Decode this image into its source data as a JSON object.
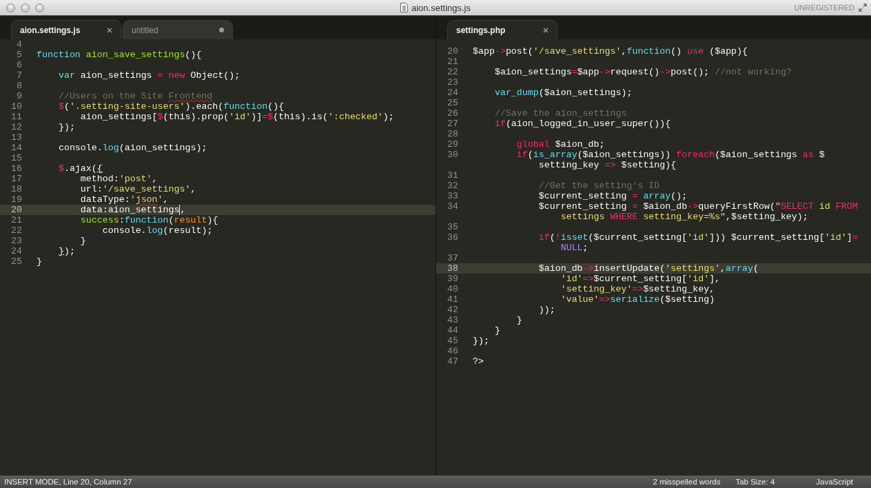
{
  "window": {
    "title": "aion.settings.js",
    "badge": "UNREGISTERED"
  },
  "panes": [
    {
      "tabs": [
        {
          "label": "aion.settings.js",
          "selected": true,
          "modified": false
        },
        {
          "label": "untitled",
          "selected": false,
          "modified": true
        }
      ],
      "lines": [
        {
          "number": "4",
          "current": false
        },
        {
          "number": "5",
          "current": false,
          "tokens": [
            {
              "kind": "type",
              "text": "function"
            },
            {
              "kind": "name",
              "text": " aion_save_settings"
            },
            {
              "kind": "plain",
              "text": "(){"
            }
          ]
        },
        {
          "number": "6",
          "current": false
        },
        {
          "number": "7",
          "current": false,
          "tokens": [
            {
              "kind": "type",
              "text": "    var"
            },
            {
              "kind": "plain",
              "text": " aion_settings "
            },
            {
              "kind": "keyword",
              "text": "="
            },
            {
              "kind": "keyword",
              "text": " new"
            },
            {
              "kind": "plain",
              "text": " Object();"
            }
          ]
        },
        {
          "number": "8",
          "current": false
        },
        {
          "number": "9",
          "current": false,
          "tokens": [
            {
              "kind": "comment",
              "text": "    //Users on the Site"
            },
            {
              "kind": "comment",
              "text": " Frontend",
              "misspelled": true
            }
          ]
        },
        {
          "number": "10",
          "current": false,
          "tokens": [
            {
              "kind": "keyword",
              "text": "    $"
            },
            {
              "kind": "plain",
              "text": "("
            },
            {
              "kind": "string",
              "text": "'.setting-site-users'"
            },
            {
              "kind": "plain",
              "text": ").each("
            },
            {
              "kind": "type",
              "text": "function"
            },
            {
              "kind": "plain",
              "text": "(){"
            }
          ]
        },
        {
          "number": "11",
          "current": false,
          "tokens": [
            {
              "kind": "plain",
              "text": "        aion_settings["
            },
            {
              "kind": "keyword",
              "text": "$"
            },
            {
              "kind": "plain",
              "text": "(this).prop("
            },
            {
              "kind": "string",
              "text": "'id'"
            },
            {
              "kind": "plain",
              "text": ")]"
            },
            {
              "kind": "keyword",
              "text": "="
            },
            {
              "kind": "keyword",
              "text": "$"
            },
            {
              "kind": "plain",
              "text": "(this).is("
            },
            {
              "kind": "string",
              "text": "':checked'"
            },
            {
              "kind": "plain",
              "text": ");"
            }
          ]
        },
        {
          "number": "12",
          "current": false,
          "tokens": [
            {
              "kind": "plain",
              "text": "    });"
            }
          ]
        },
        {
          "number": "13",
          "current": false
        },
        {
          "number": "14",
          "current": false,
          "tokens": [
            {
              "kind": "plain",
              "text": "    console."
            },
            {
              "kind": "type",
              "text": "log"
            },
            {
              "kind": "plain",
              "text": "(aion_settings);"
            }
          ]
        },
        {
          "number": "15",
          "current": false
        },
        {
          "number": "16",
          "current": false,
          "tokens": [
            {
              "kind": "keyword",
              "text": "    $"
            },
            {
              "kind": "plain",
              "text": ".ajax("
            },
            {
              "kind": "plain",
              "text": "{",
              "matched": true
            }
          ]
        },
        {
          "number": "17",
          "current": false,
          "tokens": [
            {
              "kind": "plain",
              "text": "        method:"
            },
            {
              "kind": "string",
              "text": "'post'"
            },
            {
              "kind": "plain",
              "text": ","
            }
          ]
        },
        {
          "number": "18",
          "current": false,
          "tokens": [
            {
              "kind": "plain",
              "text": "        url:"
            },
            {
              "kind": "string",
              "text": "'/save_settings'"
            },
            {
              "kind": "plain",
              "text": ","
            }
          ]
        },
        {
          "number": "19",
          "current": false,
          "tokens": [
            {
              "kind": "plain",
              "text": "        dataType:"
            },
            {
              "kind": "string",
              "text": "'"
            },
            {
              "kind": "string",
              "text": "json",
              "misspelled": true
            },
            {
              "kind": "string",
              "text": "'"
            },
            {
              "kind": "plain",
              "text": ","
            }
          ]
        },
        {
          "number": "20",
          "current": true,
          "tokens": [
            {
              "kind": "plain",
              "text": "        data:aion_settings",
              "caret": true
            },
            {
              "kind": "plain",
              "text": ","
            }
          ]
        },
        {
          "number": "21",
          "current": false,
          "tokens": [
            {
              "kind": "name",
              "text": "        success"
            },
            {
              "kind": "plain",
              "text": ":"
            },
            {
              "kind": "type",
              "text": "function"
            },
            {
              "kind": "plain",
              "text": "("
            },
            {
              "kind": "param",
              "text": "result"
            },
            {
              "kind": "plain",
              "text": "){"
            }
          ]
        },
        {
          "number": "22",
          "current": false,
          "tokens": [
            {
              "kind": "plain",
              "text": "            console."
            },
            {
              "kind": "type",
              "text": "log"
            },
            {
              "kind": "plain",
              "text": "(result);"
            }
          ]
        },
        {
          "number": "23",
          "current": false,
          "tokens": [
            {
              "kind": "plain",
              "text": "        }"
            }
          ]
        },
        {
          "number": "24",
          "current": false,
          "tokens": [
            {
              "kind": "plain",
              "text": "    }",
              "matched": true
            },
            {
              "kind": "plain",
              "text": ");"
            }
          ]
        },
        {
          "number": "25",
          "current": false,
          "tokens": [
            {
              "kind": "plain",
              "text": "}"
            }
          ]
        }
      ]
    },
    {
      "tabs": [
        {
          "label": "settings.php",
          "selected": true,
          "modified": false
        }
      ],
      "lines": [
        {
          "number": "20",
          "current": false,
          "tokens": [
            {
              "kind": "plain",
              "text": "$app"
            },
            {
              "kind": "keyword",
              "text": "->"
            },
            {
              "kind": "plain",
              "text": "post("
            },
            {
              "kind": "string",
              "text": "'/save_settings'"
            },
            {
              "kind": "plain",
              "text": ","
            },
            {
              "kind": "type",
              "text": "function"
            },
            {
              "kind": "plain",
              "text": "()"
            },
            {
              "kind": "keyword",
              "text": " use"
            },
            {
              "kind": "plain",
              "text": " ($app){"
            }
          ]
        },
        {
          "number": "21",
          "current": false
        },
        {
          "number": "22",
          "current": false,
          "tokens": [
            {
              "kind": "plain",
              "text": "    $aion_settings"
            },
            {
              "kind": "keyword",
              "text": "="
            },
            {
              "kind": "plain",
              "text": "$app"
            },
            {
              "kind": "keyword",
              "text": "->"
            },
            {
              "kind": "plain",
              "text": "request()"
            },
            {
              "kind": "keyword",
              "text": "->"
            },
            {
              "kind": "plain",
              "text": "post();"
            },
            {
              "kind": "comment",
              "text": " //not working?"
            }
          ]
        },
        {
          "number": "23",
          "current": false
        },
        {
          "number": "24",
          "current": false,
          "tokens": [
            {
              "kind": "type",
              "text": "    var_dump"
            },
            {
              "kind": "plain",
              "text": "($aion_settings);"
            }
          ]
        },
        {
          "number": "25",
          "current": false
        },
        {
          "number": "26",
          "current": false,
          "tokens": [
            {
              "kind": "comment",
              "text": "    //Save the aion_settings"
            }
          ]
        },
        {
          "number": "27",
          "current": false,
          "tokens": [
            {
              "kind": "keyword",
              "text": "    if"
            },
            {
              "kind": "plain",
              "text": "(aion_logged_in_user_super()){"
            }
          ]
        },
        {
          "number": "28",
          "current": false
        },
        {
          "number": "29",
          "current": false,
          "tokens": [
            {
              "kind": "keyword",
              "text": "        global"
            },
            {
              "kind": "plain",
              "text": " $aion_db;"
            }
          ]
        },
        {
          "number": "30",
          "current": false,
          "tokens": [
            {
              "kind": "keyword",
              "text": "        if"
            },
            {
              "kind": "plain",
              "text": "("
            },
            {
              "kind": "type",
              "text": "is_array"
            },
            {
              "kind": "plain",
              "text": "($aion_settings))"
            },
            {
              "kind": "keyword",
              "text": " foreach"
            },
            {
              "kind": "plain",
              "text": "($aion_settings"
            },
            {
              "kind": "keyword",
              "text": " as"
            },
            {
              "kind": "plain",
              "text": " $"
            }
          ],
          "wrap": [
            {
              "kind": "plain",
              "text": "            setting_key"
            },
            {
              "kind": "keyword",
              "text": " =>"
            },
            {
              "kind": "plain",
              "text": " $setting){"
            }
          ]
        },
        {
          "number": "31",
          "current": false
        },
        {
          "number": "32",
          "current": false,
          "tokens": [
            {
              "kind": "comment",
              "text": "            //Get the setting's ID"
            }
          ]
        },
        {
          "number": "33",
          "current": false,
          "tokens": [
            {
              "kind": "plain",
              "text": "            $current_setting"
            },
            {
              "kind": "keyword",
              "text": " ="
            },
            {
              "kind": "type",
              "text": " array"
            },
            {
              "kind": "plain",
              "text": "();"
            }
          ]
        },
        {
          "number": "34",
          "current": false,
          "tokens": [
            {
              "kind": "plain",
              "text": "            $current_setting"
            },
            {
              "kind": "keyword",
              "text": " ="
            },
            {
              "kind": "plain",
              "text": " $aion_db"
            },
            {
              "kind": "keyword",
              "text": "->"
            },
            {
              "kind": "plain",
              "text": "queryFirstRow("
            },
            {
              "kind": "string",
              "text": "\""
            },
            {
              "kind": "keyword",
              "text": "SELECT"
            },
            {
              "kind": "string",
              "text": " id"
            },
            {
              "kind": "keyword",
              "text": " FROM"
            }
          ],
          "wrap": [
            {
              "kind": "string",
              "text": "                settings"
            },
            {
              "kind": "keyword",
              "text": " WHERE"
            },
            {
              "kind": "string",
              "text": " setting_key=%s\""
            },
            {
              "kind": "plain",
              "text": ",$setting_key);"
            }
          ]
        },
        {
          "number": "35",
          "current": false
        },
        {
          "number": "36",
          "current": false,
          "tokens": [
            {
              "kind": "keyword",
              "text": "            if"
            },
            {
              "kind": "plain",
              "text": "("
            },
            {
              "kind": "keyword",
              "text": "!"
            },
            {
              "kind": "type",
              "text": "isset"
            },
            {
              "kind": "plain",
              "text": "($current_setting["
            },
            {
              "kind": "string",
              "text": "'id'"
            },
            {
              "kind": "plain",
              "text": "])) $current_setting["
            },
            {
              "kind": "string",
              "text": "'id'"
            },
            {
              "kind": "plain",
              "text": "]"
            },
            {
              "kind": "keyword",
              "text": "="
            }
          ],
          "wrap": [
            {
              "kind": "constant",
              "text": "                NULL"
            },
            {
              "kind": "plain",
              "text": ";"
            }
          ]
        },
        {
          "number": "37",
          "current": false
        },
        {
          "number": "38",
          "current": true,
          "tokens": [
            {
              "kind": "plain",
              "text": "            $aion_db"
            },
            {
              "kind": "keyword",
              "text": "->"
            },
            {
              "kind": "plain",
              "text": "insertUpdate("
            },
            {
              "kind": "string",
              "text": "'settings'"
            },
            {
              "kind": "plain",
              "text": ","
            },
            {
              "kind": "type",
              "text": "array"
            },
            {
              "kind": "plain",
              "text": "("
            }
          ]
        },
        {
          "number": "39",
          "current": false,
          "tokens": [
            {
              "kind": "string",
              "text": "                'id'"
            },
            {
              "kind": "keyword",
              "text": "=>"
            },
            {
              "kind": "plain",
              "text": "$current_setting["
            },
            {
              "kind": "string",
              "text": "'id'"
            },
            {
              "kind": "plain",
              "text": "],"
            }
          ]
        },
        {
          "number": "40",
          "current": false,
          "tokens": [
            {
              "kind": "string",
              "text": "                'setting_key'"
            },
            {
              "kind": "keyword",
              "text": "=>"
            },
            {
              "kind": "plain",
              "text": "$setting_key,"
            }
          ]
        },
        {
          "number": "41",
          "current": false,
          "tokens": [
            {
              "kind": "string",
              "text": "                'value'"
            },
            {
              "kind": "keyword",
              "text": "=>"
            },
            {
              "kind": "type",
              "text": "serialize"
            },
            {
              "kind": "plain",
              "text": "($setting)"
            }
          ]
        },
        {
          "number": "42",
          "current": false,
          "tokens": [
            {
              "kind": "plain",
              "text": "            ));"
            }
          ]
        },
        {
          "number": "43",
          "current": false,
          "tokens": [
            {
              "kind": "plain",
              "text": "        }"
            }
          ]
        },
        {
          "number": "44",
          "current": false,
          "tokens": [
            {
              "kind": "plain",
              "text": "    }"
            }
          ]
        },
        {
          "number": "45",
          "current": false,
          "tokens": [
            {
              "kind": "plain",
              "text": "});"
            }
          ]
        },
        {
          "number": "46",
          "current": false
        },
        {
          "number": "47",
          "current": false,
          "tokens": [
            {
              "kind": "plain",
              "text": "?>"
            }
          ]
        }
      ]
    }
  ],
  "status_bar": {
    "mode": "INSERT MODE, Line 20, Column 27",
    "items": [
      "2 misspelled words",
      "Tab Size: 4",
      "JavaScript"
    ]
  }
}
